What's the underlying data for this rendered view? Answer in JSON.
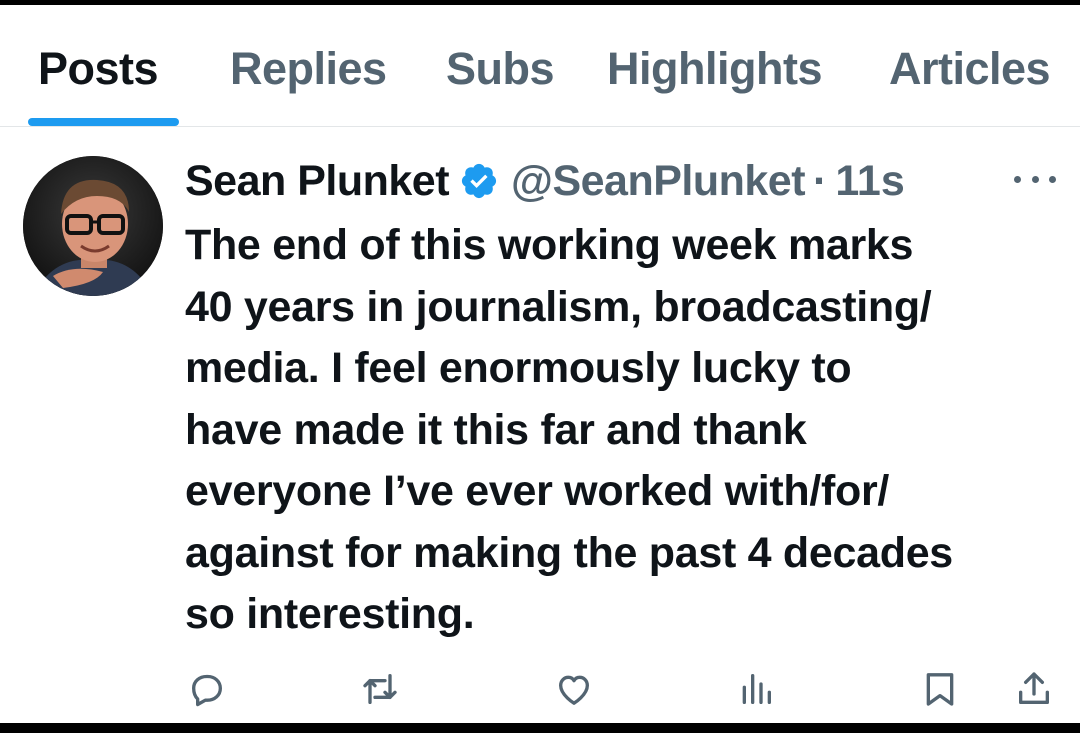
{
  "tabs": [
    {
      "label": "Posts",
      "active": true
    },
    {
      "label": "Replies",
      "active": false
    },
    {
      "label": "Subs",
      "active": false
    },
    {
      "label": "Highlights",
      "active": false
    },
    {
      "label": "Articles",
      "active": false
    }
  ],
  "tweet": {
    "author_name": "Sean Plunket",
    "handle": "@SeanPlunket",
    "separator": "·",
    "time": "11s",
    "verified": true,
    "text_lines": [
      "The end of this working week marks",
      "40 years in journalism, broadcasting/",
      "media. I feel enormously lucky to",
      "have made it this far and thank",
      "everyone I’ve ever worked with/for/",
      "against for making the past 4 decades",
      "so interesting."
    ]
  },
  "actions": {
    "icons": [
      "reply-icon",
      "repost-icon",
      "like-icon",
      "views-icon",
      "bookmark-icon",
      "share-icon"
    ]
  },
  "colors": {
    "accent": "#1d9bf0",
    "text_primary": "#0f1419",
    "text_secondary": "#536471"
  }
}
